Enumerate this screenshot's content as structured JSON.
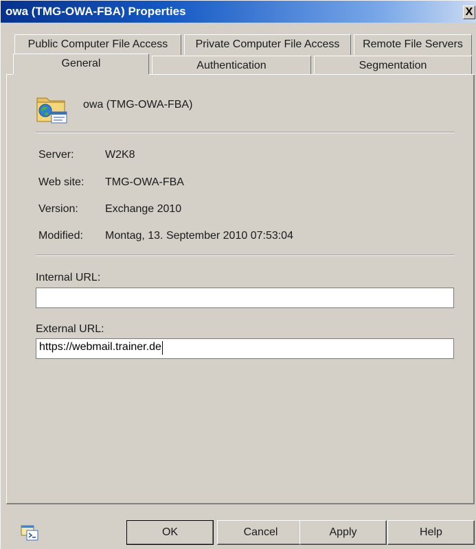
{
  "window": {
    "title": "owa (TMG-OWA-FBA) Properties",
    "close_symbol": "X"
  },
  "tabs": {
    "row1": [
      {
        "label": "Public Computer File Access"
      },
      {
        "label": "Private Computer File Access"
      },
      {
        "label": "Remote File Servers"
      }
    ],
    "row2": [
      {
        "label": "General",
        "selected": true
      },
      {
        "label": "Authentication"
      },
      {
        "label": "Segmentation"
      }
    ]
  },
  "object": {
    "name": "owa (TMG-OWA-FBA)",
    "icon": "web-publishing-rule-icon"
  },
  "details": [
    {
      "label": "Server:",
      "value": "W2K8"
    },
    {
      "label": "Web site:",
      "value": "TMG-OWA-FBA"
    },
    {
      "label": "Version:",
      "value": "Exchange 2010"
    },
    {
      "label": "Modified:",
      "value": "Montag, 13. September 2010 07:53:04"
    }
  ],
  "internal_url": {
    "label": "Internal URL:",
    "value": ""
  },
  "external_url": {
    "label": "External URL:",
    "value": "https://webmail.trainer.de"
  },
  "buttons": {
    "ok": "OK",
    "cancel": "Cancel",
    "apply": "Apply",
    "help": "Help"
  },
  "colors": {
    "dialog_bg": "#d4d0c8",
    "title_bar": "#1459c4"
  }
}
